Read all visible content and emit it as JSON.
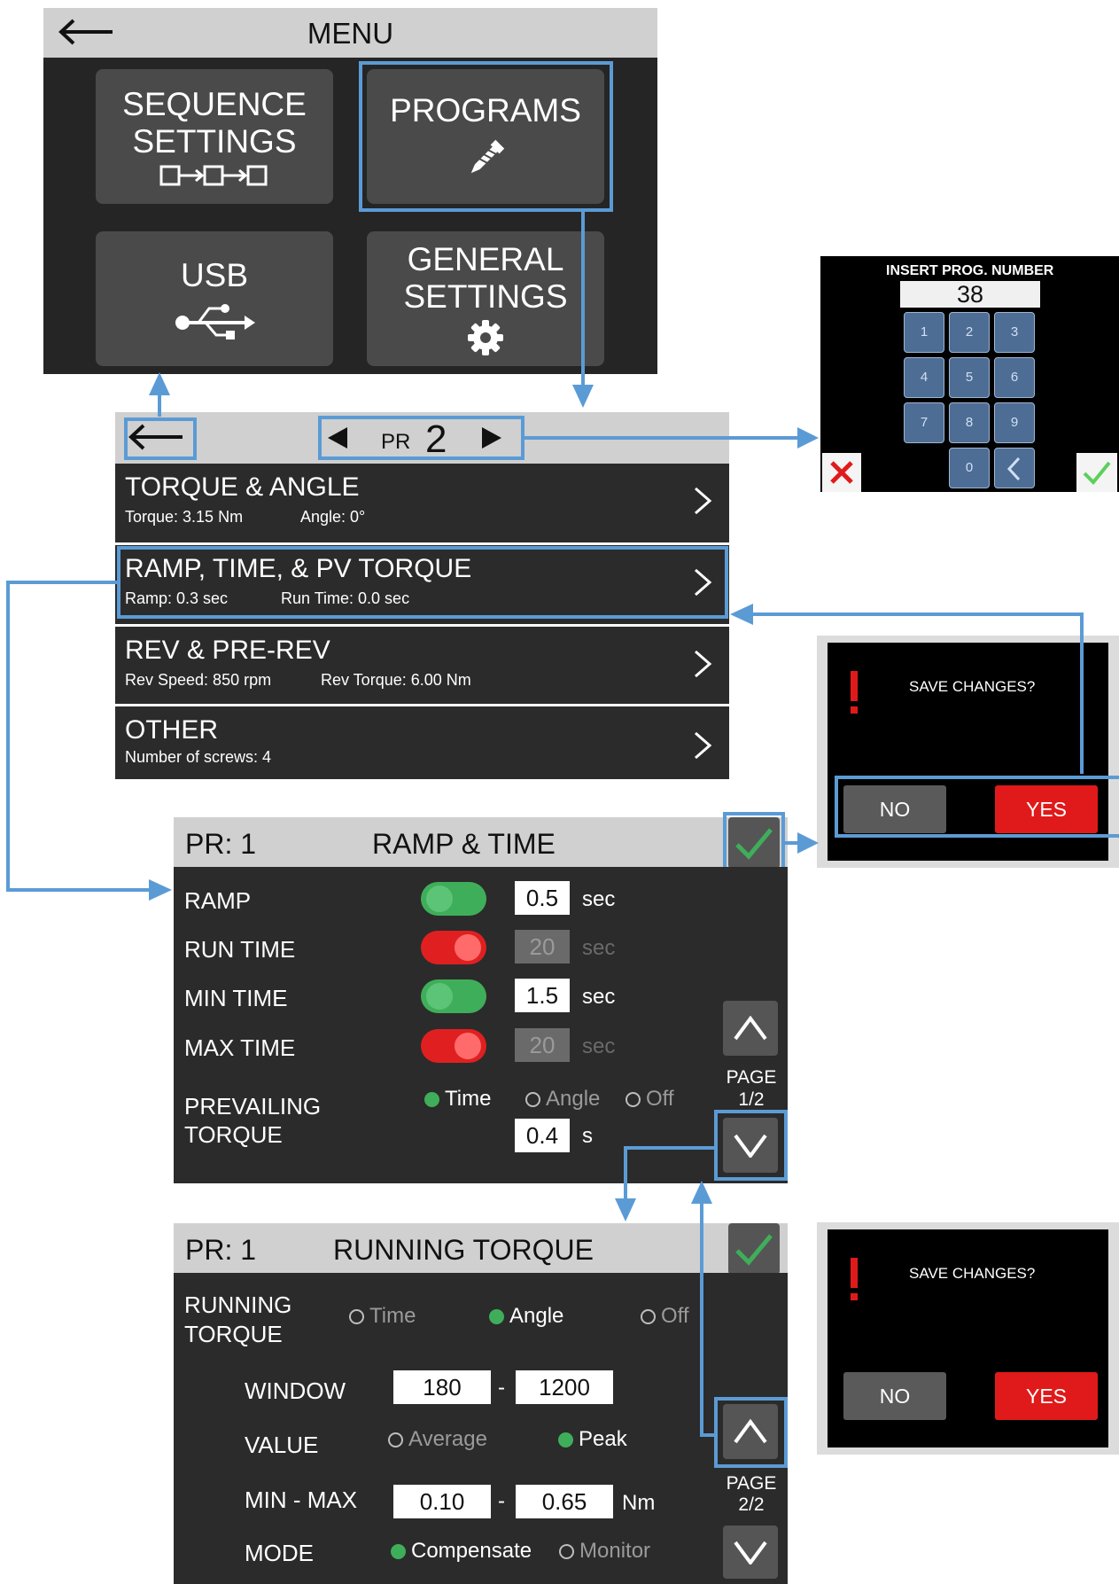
{
  "menu": {
    "title": "MENU",
    "tiles": {
      "sequence": {
        "line1": "SEQUENCE",
        "line2": "SETTINGS"
      },
      "programs": {
        "line1": "PROGRAMS"
      },
      "usb": {
        "line1": "USB"
      },
      "general": {
        "line1": "GENERAL",
        "line2": "SETTINGS"
      }
    }
  },
  "program_list": {
    "pr_label": "PR",
    "pr_number": "2",
    "items": [
      {
        "title": "TORQUE & ANGLE",
        "sub1": "Torque: 3.15 Nm",
        "sub2": "Angle: 0°"
      },
      {
        "title": "RAMP, TIME, & PV TORQUE",
        "sub1": "Ramp: 0.3 sec",
        "sub2": "Run Time: 0.0 sec"
      },
      {
        "title": "REV & PRE-REV",
        "sub1": "Rev Speed: 850 rpm",
        "sub2": "Rev Torque: 6.00 Nm"
      },
      {
        "title": "OTHER",
        "sub1": "Number of screws: 4",
        "sub2": ""
      }
    ]
  },
  "keypad": {
    "title": "INSERT PROG. NUMBER",
    "value": "38",
    "keys": [
      "1",
      "2",
      "3",
      "4",
      "5",
      "6",
      "7",
      "8",
      "9",
      "0"
    ]
  },
  "save_dialog": {
    "message": "SAVE CHANGES?",
    "no": "NO",
    "yes": "YES",
    "background_hint": "USB"
  },
  "ramp_time": {
    "pr": "PR: 1",
    "title": "RAMP & TIME",
    "rows": [
      {
        "label": "RAMP",
        "enabled": true,
        "value": "0.5",
        "unit": "sec"
      },
      {
        "label": "RUN TIME",
        "enabled": false,
        "value": "20",
        "unit": "sec"
      },
      {
        "label": "MIN TIME",
        "enabled": true,
        "value": "1.5",
        "unit": "sec"
      },
      {
        "label": "MAX TIME",
        "enabled": false,
        "value": "20",
        "unit": "sec"
      }
    ],
    "prevailing": {
      "label1": "PREVAILING",
      "label2": "TORQUE",
      "options": [
        "Time",
        "Angle",
        "Off"
      ],
      "selected": "Time",
      "value": "0.4",
      "unit": "s"
    },
    "page": {
      "label": "PAGE",
      "value": "1/2"
    }
  },
  "running_torque": {
    "pr": "PR: 1",
    "title": "RUNNING TORQUE",
    "label1": "RUNNING",
    "label2": "TORQUE",
    "options": [
      "Time",
      "Angle",
      "Off"
    ],
    "selected": "Angle",
    "window": {
      "label": "WINDOW",
      "min": "180",
      "max": "1200",
      "sep": "-"
    },
    "value_row": {
      "label": "VALUE",
      "options": [
        "Average",
        "Peak"
      ],
      "selected": "Peak"
    },
    "minmax": {
      "label": "MIN - MAX",
      "min": "0.10",
      "max": "0.65",
      "sep": "-",
      "unit": "Nm"
    },
    "mode": {
      "label": "MODE",
      "options": [
        "Compensate",
        "Monitor"
      ],
      "selected": "Compensate"
    },
    "page": {
      "label": "PAGE",
      "value": "2/2"
    }
  },
  "colors": {
    "accent_blue": "#5b9bd5",
    "toggle_on": "#3fae5a",
    "toggle_off": "#e02020",
    "yes_red": "#e01a1a"
  }
}
